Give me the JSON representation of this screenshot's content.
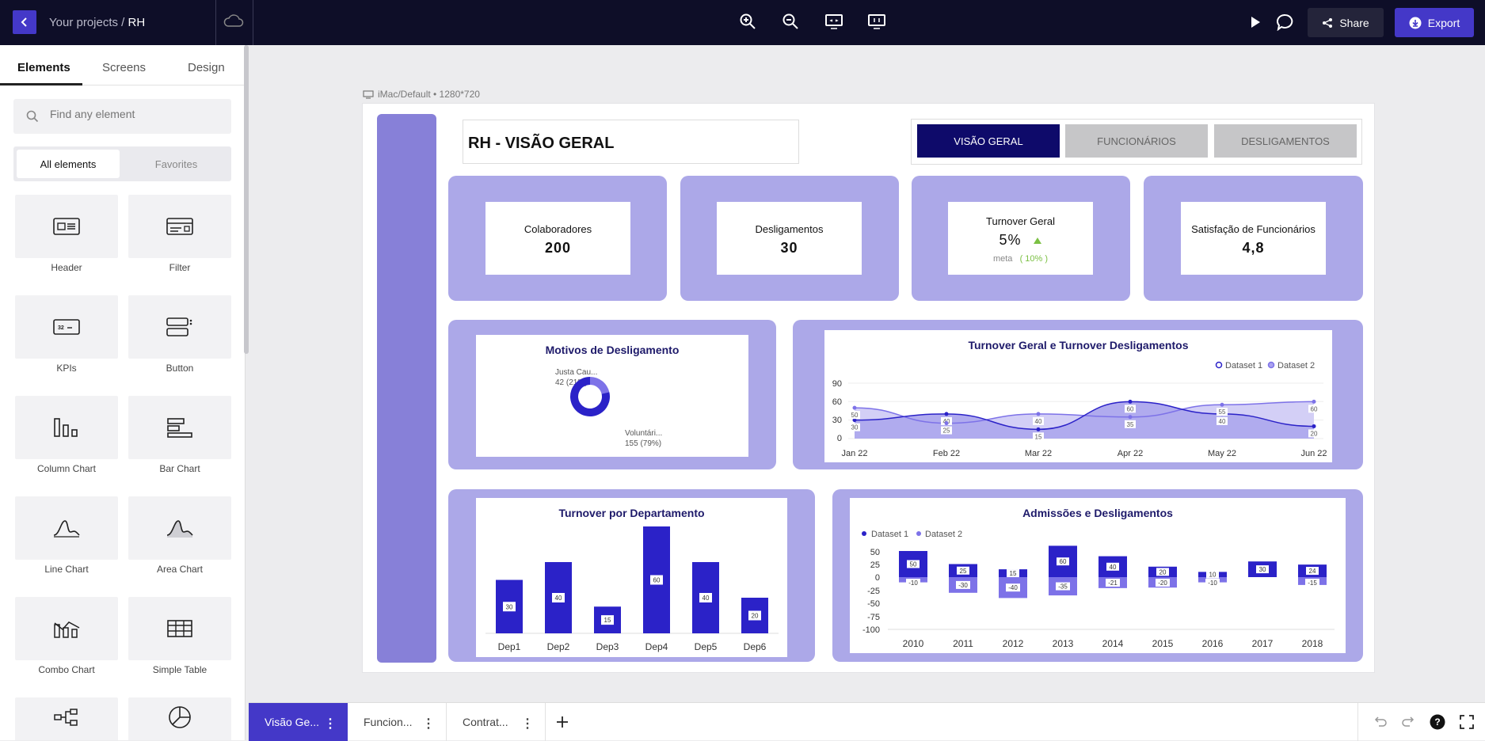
{
  "topbar": {
    "crumb_prefix": "Your projects / ",
    "crumb_project": "RH",
    "share_label": "Share",
    "export_label": "Export",
    "colors": {
      "bg": "#0e0e28",
      "accent": "#4438c8"
    }
  },
  "sidebar": {
    "tabs": [
      {
        "label": "Elements"
      },
      {
        "label": "Screens"
      },
      {
        "label": "Design"
      }
    ],
    "search_placeholder": "Find any element",
    "segment_all": "All elements",
    "segment_fav": "Favorites",
    "elements": [
      {
        "label": "Header",
        "icon": "header-icon"
      },
      {
        "label": "Filter",
        "icon": "filter-icon"
      },
      {
        "label": "KPIs",
        "icon": "kpi-icon"
      },
      {
        "label": "Button",
        "icon": "button-icon"
      },
      {
        "label": "Column Chart",
        "icon": "column-chart-icon"
      },
      {
        "label": "Bar Chart",
        "icon": "bar-chart-icon"
      },
      {
        "label": "Line Chart",
        "icon": "line-chart-icon"
      },
      {
        "label": "Area Chart",
        "icon": "area-chart-icon"
      },
      {
        "label": "Combo Chart",
        "icon": "combo-chart-icon"
      },
      {
        "label": "Simple Table",
        "icon": "table-icon"
      }
    ]
  },
  "canvas": {
    "frame_label": "iMac/Default • 1280*720",
    "title": "RH - VISÃO GERAL",
    "nav": [
      {
        "label": "VISÃO GERAL",
        "active": true
      },
      {
        "label": "FUNCIONÁRIOS",
        "active": false
      },
      {
        "label": "DESLIGAMENTOS",
        "active": false
      }
    ],
    "kpis": [
      {
        "label": "Colaboradores",
        "value": "200"
      },
      {
        "label": "Desligamentos",
        "value": "30"
      },
      {
        "label": "Turnover Geral",
        "value": "5%",
        "sub_label": "meta",
        "sub_value": "( 10% )",
        "trend": "up"
      },
      {
        "label": "Satisfação de Funcionários",
        "value": "4,8"
      }
    ],
    "colors": {
      "card": "#aca8e8",
      "sidebar_strip": "#8780d8",
      "dark": "#2b22c8",
      "light": "#7d72e8",
      "nav_active": "#0e0a6a",
      "nav_inactive": "#c6c6c8"
    }
  },
  "charts": {
    "donut": {
      "title": "Motivos de Desligamento",
      "slices": [
        {
          "name": "Justa Cau...",
          "label": "42 (21%)"
        },
        {
          "name": "Voluntári...",
          "label": "155 (79%)"
        }
      ]
    },
    "line": {
      "title": "Turnover Geral e Turnover Desligamentos",
      "legend": [
        "Dataset 1",
        "Dataset 2"
      ],
      "y_ticks": [
        "90",
        "60",
        "30",
        "0"
      ],
      "x_ticks": [
        "Jan 22",
        "Feb 22",
        "Mar 22",
        "Apr 22",
        "May 22",
        "Jun 22"
      ]
    },
    "bars": {
      "title": "Turnover por Departamento",
      "x_ticks": [
        "Dep1",
        "Dep2",
        "Dep3",
        "Dep4",
        "Dep5",
        "Dep6"
      ]
    },
    "stacked": {
      "title": "Admissões e Desligamentos",
      "legend": [
        "Dataset 1",
        "Dataset 2"
      ],
      "y_ticks": [
        "50",
        "25",
        "0",
        "-25",
        "-50",
        "-75",
        "-100"
      ],
      "x_ticks": [
        "2010",
        "2011",
        "2012",
        "2013",
        "2014",
        "2015",
        "2016",
        "2017",
        "2018"
      ]
    }
  },
  "chart_data": [
    {
      "type": "pie",
      "title": "Motivos de Desligamento",
      "categories": [
        "Justa Cau...",
        "Voluntári..."
      ],
      "values": [
        42,
        155
      ]
    },
    {
      "type": "area",
      "title": "Turnover Geral e Turnover Desligamentos",
      "categories": [
        "Jan 22",
        "Feb 22",
        "Mar 22",
        "Apr 22",
        "May 22",
        "Jun 22"
      ],
      "series": [
        {
          "name": "Dataset 1",
          "values": [
            30,
            40,
            15,
            60,
            40,
            20
          ]
        },
        {
          "name": "Dataset 2",
          "values": [
            50,
            25,
            40,
            35,
            55,
            60
          ]
        }
      ],
      "ylim": [
        0,
        90
      ]
    },
    {
      "type": "bar",
      "title": "Turnover por Departamento",
      "categories": [
        "Dep1",
        "Dep2",
        "Dep3",
        "Dep4",
        "Dep5",
        "Dep6"
      ],
      "values": [
        30,
        40,
        15,
        60,
        40,
        20
      ]
    },
    {
      "type": "bar",
      "title": "Admissões e Desligamentos",
      "categories": [
        "2010",
        "2011",
        "2012",
        "2013",
        "2014",
        "2015",
        "2016",
        "2017",
        "2018"
      ],
      "series": [
        {
          "name": "Dataset 1",
          "values": [
            50,
            25,
            15,
            60,
            40,
            20,
            10,
            30,
            24
          ]
        },
        {
          "name": "Dataset 2",
          "values": [
            -10,
            -30,
            -40,
            -35,
            -21,
            -20,
            -10,
            0,
            -15
          ]
        }
      ],
      "ylim": [
        -100,
        50
      ]
    }
  ],
  "bottombar": {
    "screens": [
      {
        "label": "Visão Ge...",
        "active": true
      },
      {
        "label": "Funcion...",
        "active": false
      },
      {
        "label": "Contrat...",
        "active": false
      }
    ]
  }
}
